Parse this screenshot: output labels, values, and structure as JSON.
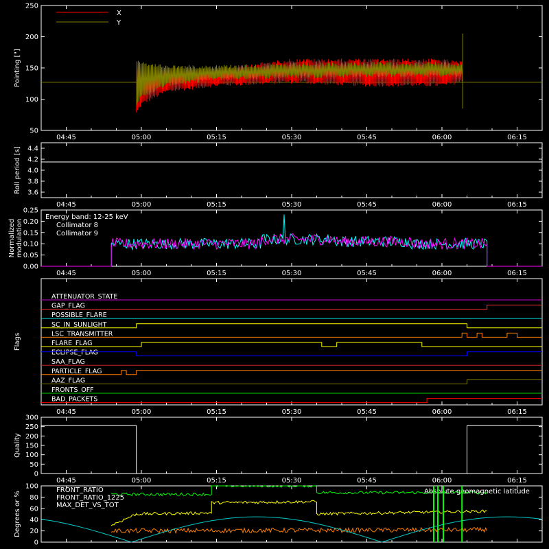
{
  "colors": {
    "background": "#000000",
    "axes": "#ffffff",
    "pointing_x": "#ff0000",
    "pointing_y": "#808000",
    "collimator_8": "#00ffff",
    "collimator_9": "#ff00ff",
    "front_ratio": "#00ff00",
    "front_ratio_1225": "#ffff00",
    "max_det_vs_tot": "#ff8000",
    "geomag": "#00cccc"
  },
  "time_ticks": [
    "04:45",
    "05:00",
    "05:15",
    "05:30",
    "05:45",
    "06:00",
    "06:15"
  ],
  "chart_data": [
    {
      "id": "pointing",
      "type": "line",
      "ylabel": "Pointing [\"]",
      "ylim": [
        50,
        250
      ],
      "yticks": [
        "250",
        "200",
        "150",
        "100",
        "50"
      ],
      "legend": "top-left",
      "series": [
        {
          "name": "X",
          "color": "#ff0000",
          "x": [
            "04:59",
            "05:00",
            "05:05",
            "05:15",
            "05:30",
            "05:45",
            "06:00",
            "06:04"
          ],
          "upper": [
            165,
            140,
            150,
            150,
            165,
            165,
            165,
            160
          ],
          "lower": [
            75,
            90,
            110,
            120,
            125,
            120,
            120,
            125
          ]
        },
        {
          "name": "Y",
          "color": "#808000",
          "x": [
            "04:59",
            "05:00",
            "05:05",
            "05:15",
            "05:30",
            "05:45",
            "06:00",
            "06:04"
          ],
          "upper": [
            163,
            160,
            155,
            155,
            158,
            160,
            160,
            158
          ],
          "lower": [
            90,
            100,
            120,
            130,
            133,
            135,
            135,
            135
          ]
        }
      ],
      "baseline": 127
    },
    {
      "id": "roll",
      "type": "line",
      "ylabel": "Roll period [s]",
      "ylim": [
        3.5,
        4.5
      ],
      "yticks": [
        "4.4",
        "4.2",
        "4.0",
        "3.8",
        "3.6"
      ],
      "series": [
        {
          "name": "",
          "x": [
            "04:40",
            "06:20"
          ],
          "values": [
            4.15,
            4.15
          ]
        }
      ]
    },
    {
      "id": "modulation",
      "type": "line",
      "ylabel": "Normalized modulation",
      "ylim": [
        0,
        0.25
      ],
      "yticks": [
        "0.25",
        "0.20",
        "0.15",
        "0.10",
        "0.05",
        "0.00"
      ],
      "annotation": "Energy band: 12-25 keV",
      "legend": "top-left",
      "series": [
        {
          "name": "Collimator 8",
          "color": "#00ffff",
          "start": "04:54",
          "end": "06:09",
          "mean": [
            0.1,
            0.1,
            0.12,
            0.11,
            0.1
          ],
          "spike_max": 0.23
        },
        {
          "name": "Collimator 9",
          "color": "#ff00ff",
          "start": "04:54",
          "end": "06:09",
          "mean": [
            0.1,
            0.1,
            0.12,
            0.11,
            0.1
          ]
        }
      ]
    },
    {
      "id": "flags",
      "type": "table",
      "ylabel": "Flags",
      "rows": [
        {
          "label": "ATTENUATOR_STATE",
          "color": "#cc00cc",
          "steps": []
        },
        {
          "label": "GAP_FLAG",
          "color": "#ff3030",
          "steps": [
            [
              "06:09",
              1
            ]
          ]
        },
        {
          "label": "POSSIBLE_FLARE",
          "color": "#00cccc",
          "steps": []
        },
        {
          "label": "SC_IN_SUNLIGHT",
          "color": "#ffff00",
          "steps": [
            [
              "04:40",
              0
            ],
            [
              "04:59",
              1
            ],
            [
              "06:05",
              0
            ]
          ]
        },
        {
          "label": "LSC_TRANSMITTER",
          "color": "#ff8000",
          "steps": [
            [
              "06:04",
              1
            ],
            [
              "06:05",
              0
            ],
            [
              "06:07",
              1
            ],
            [
              "06:08",
              0
            ],
            [
              "06:13",
              1
            ],
            [
              "06:15",
              0
            ]
          ]
        },
        {
          "label": "FLARE_FLAG",
          "color": "#ffff00",
          "steps": [
            [
              "04:40",
              0
            ],
            [
              "05:00",
              1
            ],
            [
              "05:36",
              0
            ],
            [
              "05:39",
              1
            ],
            [
              "05:56",
              0
            ]
          ]
        },
        {
          "label": "ECLIPSE_FLAG",
          "color": "#0000ff",
          "steps": [
            [
              "04:40",
              1
            ],
            [
              "04:59",
              0
            ],
            [
              "06:05",
              1
            ]
          ]
        },
        {
          "label": "SAA_FLAG",
          "color": "#cc2020",
          "steps": []
        },
        {
          "label": "PARTICLE_FLAG",
          "color": "#ff8000",
          "steps": [
            [
              "04:56",
              1
            ],
            [
              "04:57",
              0
            ],
            [
              "04:59",
              1
            ]
          ]
        },
        {
          "label": "AAZ_FLAG",
          "color": "#808000",
          "steps": [
            [
              "06:05",
              1
            ]
          ]
        },
        {
          "label": "FRONTS_OFF",
          "color": "#00cc00",
          "steps": []
        },
        {
          "label": "BAD_PACKETS",
          "color": "#ff0000",
          "steps": [
            [
              "05:57",
              1
            ]
          ]
        }
      ]
    },
    {
      "id": "quality",
      "type": "line",
      "ylabel": "Quality",
      "ylim": [
        0,
        300
      ],
      "yticks": [
        "300",
        "250",
        "200",
        "150",
        "100",
        "50",
        "0"
      ],
      "series": [
        {
          "name": "",
          "x": [
            "04:40",
            "04:59",
            "04:59",
            "06:05",
            "06:05",
            "06:20"
          ],
          "values": [
            255,
            255,
            0,
            0,
            255,
            255
          ]
        }
      ]
    },
    {
      "id": "ratios",
      "type": "line",
      "ylabel": "Degrees or %",
      "ylim": [
        0,
        100
      ],
      "yticks": [
        "100",
        "80",
        "60",
        "40",
        "20",
        "0"
      ],
      "legend": "top-left",
      "series": [
        {
          "name": "FRONT_RATIO",
          "color": "#00ff00",
          "x": [
            "04:54",
            "05:14",
            "05:14",
            "05:35",
            "05:35",
            "06:09"
          ],
          "values": [
            85,
            85,
            100,
            100,
            88,
            88
          ]
        },
        {
          "name": "FRONT_RATIO_1225",
          "color": "#ffff00",
          "x": [
            "04:54",
            "04:59",
            "05:14",
            "05:14",
            "05:35",
            "05:35",
            "06:09"
          ],
          "values": [
            30,
            50,
            52,
            70,
            72,
            50,
            55
          ]
        },
        {
          "name": "MAX_DET_VS_TOT",
          "color": "#ff8000",
          "x": [
            "04:54",
            "06:09"
          ],
          "values": [
            20,
            22
          ]
        },
        {
          "name": "Absolute geomagnetic latitude",
          "color": "#00cccc",
          "x": [
            "04:40",
            "04:58",
            "05:23",
            "05:48",
            "06:13",
            "06:20"
          ],
          "values": [
            45,
            0,
            45,
            0,
            45,
            40
          ]
        }
      ]
    }
  ]
}
